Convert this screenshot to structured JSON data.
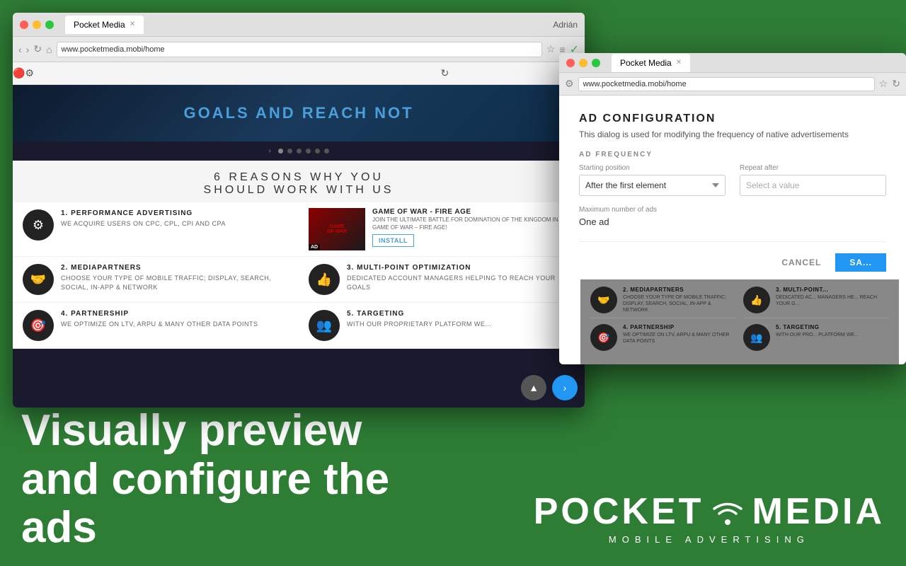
{
  "background": {
    "color": "#2e7d35"
  },
  "bottom_text": {
    "line1": "Visually preview",
    "line2": "and configure the",
    "line3": "ads"
  },
  "logo": {
    "text_part1": "POCKET",
    "text_part2": "MEDIA",
    "subtitle": "MOBILE ADVERTISING"
  },
  "browser1": {
    "tab_label": "Pocket Media",
    "url": "www.pocketmedia.mobi/home",
    "user": "Adrián",
    "hero_title": "GOALS AND REACH NOT",
    "dots": [
      "active",
      "",
      "",
      "",
      "",
      ""
    ],
    "reasons_title": "6 REASONS WHY YOU SHOULD WORK WITH US",
    "cards": [
      {
        "number": "1.",
        "title": "PERFORMANCE ADVERTISING",
        "description": "WE ACQUIRE USERS ON CPC, CPL, CPI AND CPA",
        "icon": "⚙"
      },
      {
        "ad": true,
        "title": "GAME OF WAR - FIRE AGE",
        "description": "JOIN THE ULTIMATE BATTLE FOR DOMINATION OF THE KINGDOM IN GAME OF WAR – FIRE AGE!",
        "badge": "AD",
        "install_label": "INSTALL"
      },
      {
        "number": "2.",
        "title": "MEDIAPARTNERS",
        "description": "CHOOSE YOUR TYPE OF MOBILE TRAFFIC; DISPLAY, SEARCH, SOCIAL, IN-APP & NETWORK",
        "icon": "🤝"
      },
      {
        "number": "3.",
        "title": "MULTI-POINT OPTIMIZATION",
        "description": "DEDICATED ACCOUNT MANAGERS HELPING TO REACH YOUR GOALS",
        "icon": "👍"
      },
      {
        "number": "4.",
        "title": "PARTNERSHIP",
        "description": "WE OPTIMIZE ON LTV, ARPU & MANY OTHER DATA POINTS",
        "icon": "🎯"
      },
      {
        "number": "5.",
        "title": "TARGETING",
        "description": "WITH OUR PROPRIETARY PLATFORM WE...",
        "icon": "👥"
      }
    ],
    "float_buttons": [
      "▲",
      "›"
    ]
  },
  "browser2": {
    "tab_label": "Pocket Media",
    "url": "www.pocketmedia.mobi/home",
    "dialog": {
      "title": "AD CONFIGURATION",
      "subtitle": "This dialog is used for modifying the frequency of native advertisements",
      "section_label": "AD FREQUENCY",
      "starting_position_label": "Starting position",
      "starting_position_value": "After the first element",
      "repeat_after_label": "Repeat after",
      "repeat_after_placeholder": "Select a value",
      "max_ads_label": "Maximum number of ads",
      "max_ads_value": "One ad",
      "cancel_label": "CANCEL",
      "save_label": "SA..."
    },
    "after_the_text": "After the",
    "website_cards": [
      {
        "number": "2.",
        "title": "MEDIAPARTNERS",
        "description": "CHOOSE YOUR TYPE OF MOBILE TRAFFIC; DISPLAY, SEARCH, SOCIAL, IN-APP & NETWORK",
        "icon": "🤝"
      },
      {
        "number": "3.",
        "title": "MULTI-POINT OPTIM...",
        "description": "DEDICATED AC... MANAGERS HE... REACH YOUR G...",
        "icon": "👍"
      },
      {
        "number": "4.",
        "title": "PARTNERSHIP",
        "description": "WE OPTIMIZE ON LTV, ARPU & MANY OTHER DATA POINTS",
        "icon": "🎯"
      },
      {
        "number": "5.",
        "title": "TARGETING",
        "description": "WITH OUR PRO... PLATFORM WE...",
        "icon": "👥"
      }
    ]
  }
}
